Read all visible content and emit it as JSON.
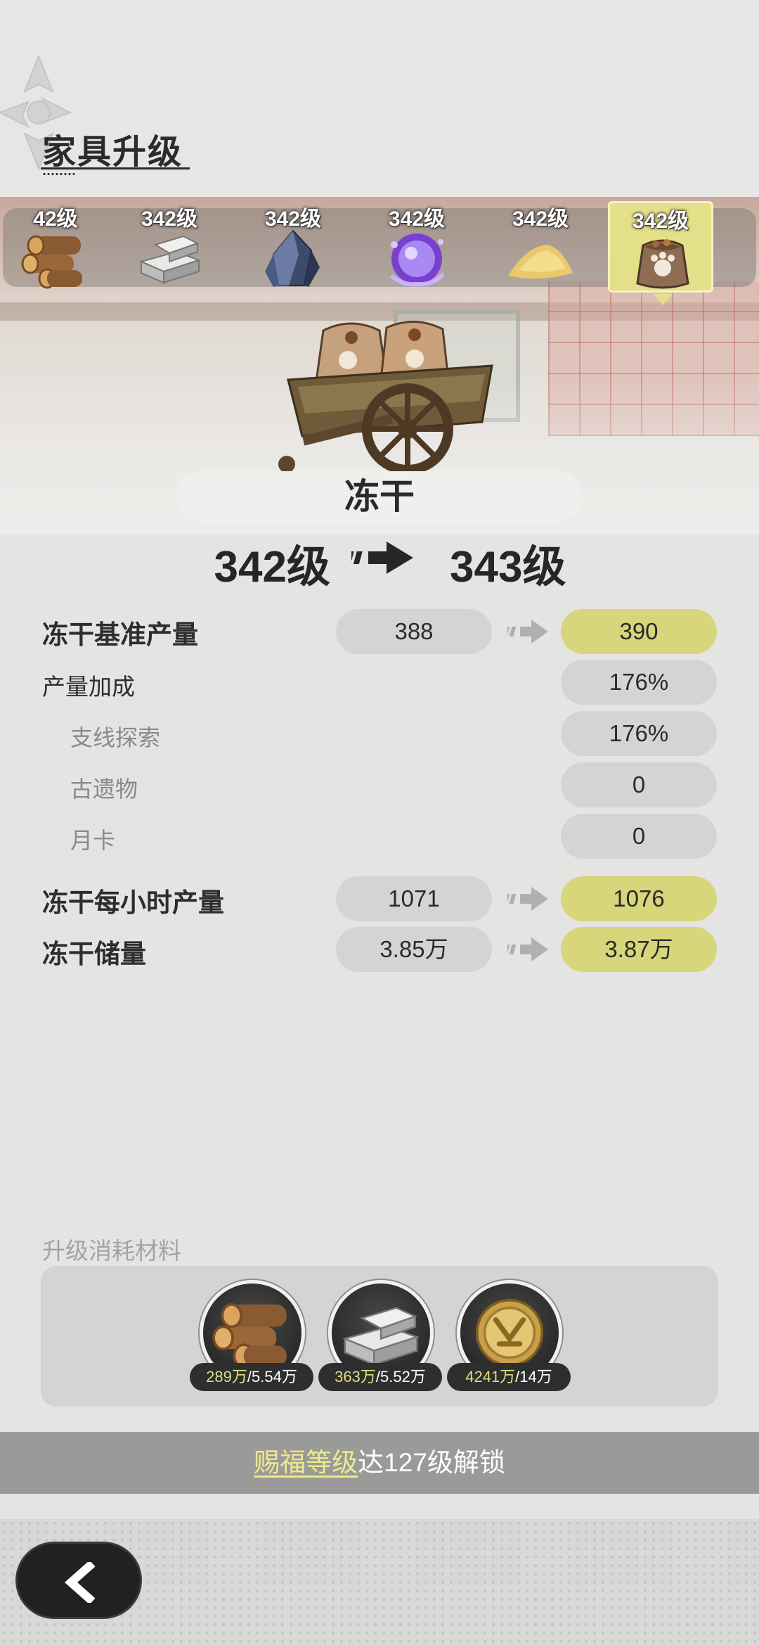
{
  "header": {
    "title": "家具升级"
  },
  "resources": [
    {
      "level": "42级",
      "icon": "wood-logs-icon",
      "selected": false
    },
    {
      "level": "342级",
      "icon": "stone-bricks-icon",
      "selected": false
    },
    {
      "level": "342级",
      "icon": "crystal-ore-icon",
      "selected": false
    },
    {
      "level": "342级",
      "icon": "magic-orb-icon",
      "selected": false
    },
    {
      "level": "342级",
      "icon": "sand-pile-icon",
      "selected": false
    },
    {
      "level": "342级",
      "icon": "freeze-dried-bag-icon",
      "selected": true
    }
  ],
  "item": {
    "name": "冻干",
    "image": "freeze-dried-cart-icon"
  },
  "level": {
    "from": "342级",
    "to": "343级"
  },
  "stats": {
    "base_output": {
      "label": "冻干基准产量",
      "old": "388",
      "new": "390"
    },
    "bonus": {
      "label": "产量加成",
      "value": "176%"
    },
    "branch": {
      "label": "支线探索",
      "value": "176%"
    },
    "relic": {
      "label": "古遗物",
      "value": "0"
    },
    "monthly": {
      "label": "月卡",
      "value": "0"
    },
    "hourly": {
      "label": "冻干每小时产量",
      "old": "1071",
      "new": "1076"
    },
    "storage": {
      "label": "冻干储量",
      "old": "3.85万",
      "new": "3.87万"
    }
  },
  "materials": {
    "title": "升级消耗材料",
    "items": [
      {
        "icon": "wood-logs-icon",
        "have": "289万",
        "need": "/5.54万"
      },
      {
        "icon": "stone-bricks-icon",
        "have": "363万",
        "need": "/5.52万"
      },
      {
        "icon": "gold-coin-icon",
        "have": "4241万",
        "need": "/14万"
      }
    ]
  },
  "unlock": {
    "highlight": "赐福等级",
    "text": "达127级解锁"
  },
  "footer": {
    "back_icon": "chevron-left-icon"
  },
  "colors": {
    "accent": "#d7d67a",
    "pill": "#d4d4d2",
    "dark": "#212121"
  }
}
